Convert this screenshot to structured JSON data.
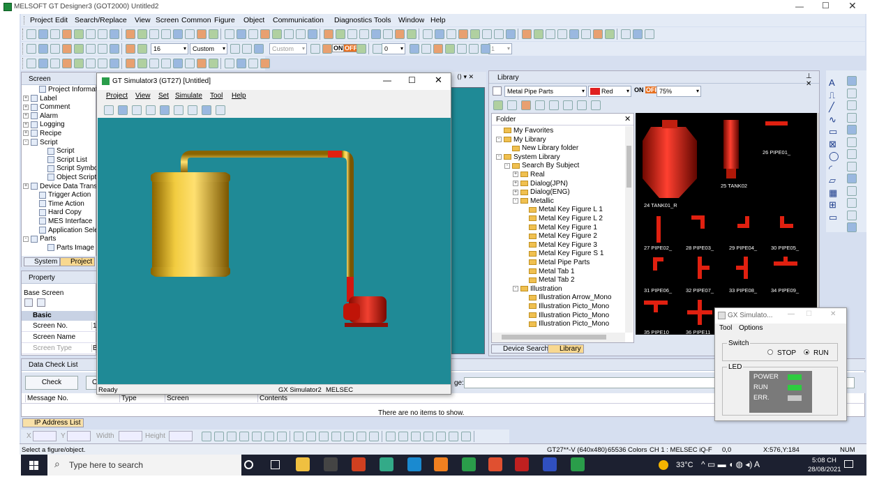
{
  "app": {
    "title": "MELSOFT GT Designer3 (GOT2000) Untitled2"
  },
  "menu": [
    "Project",
    "Edit",
    "Search/Replace",
    "View",
    "Screen",
    "Common",
    "Figure",
    "Object",
    "Communication",
    "Diagnostics",
    "Tools",
    "Window",
    "Help"
  ],
  "toolbar2": {
    "font_size": "16",
    "font_name": "Custom",
    "text_style": "Custom",
    "on_label": "ON",
    "off_label": "OFF",
    "value0": "0",
    "value1": "1"
  },
  "screen_pane": {
    "title": "Screen",
    "tabs": [
      "System",
      "Project"
    ],
    "tree": [
      {
        "label": "Project Information",
        "indent": 1,
        "exp": ""
      },
      {
        "label": "Label",
        "indent": 0,
        "exp": "+"
      },
      {
        "label": "Comment",
        "indent": 0,
        "exp": "+"
      },
      {
        "label": "Alarm",
        "indent": 0,
        "exp": "+"
      },
      {
        "label": "Logging",
        "indent": 0,
        "exp": "+"
      },
      {
        "label": "Recipe",
        "indent": 0,
        "exp": "+"
      },
      {
        "label": "Script",
        "indent": 0,
        "exp": "-"
      },
      {
        "label": "Script",
        "indent": 2,
        "exp": ""
      },
      {
        "label": "Script List",
        "indent": 2,
        "exp": ""
      },
      {
        "label": "Script Symbol",
        "indent": 2,
        "exp": ""
      },
      {
        "label": "Object Script",
        "indent": 2,
        "exp": ""
      },
      {
        "label": "Device Data Transfer",
        "indent": 0,
        "exp": "+"
      },
      {
        "label": "Trigger Action",
        "indent": 1,
        "exp": ""
      },
      {
        "label": "Time Action",
        "indent": 1,
        "exp": ""
      },
      {
        "label": "Hard Copy",
        "indent": 1,
        "exp": ""
      },
      {
        "label": "MES Interface",
        "indent": 1,
        "exp": ""
      },
      {
        "label": "Application Select",
        "indent": 1,
        "exp": ""
      },
      {
        "label": "Parts",
        "indent": 0,
        "exp": "-"
      },
      {
        "label": "Parts Image List",
        "indent": 2,
        "exp": ""
      }
    ]
  },
  "property_pane": {
    "title": "Property",
    "subtitle": "Base Screen",
    "section": "Basic",
    "rows": [
      {
        "name": "Screen No.",
        "value": "1"
      },
      {
        "name": "Screen Name",
        "value": ""
      },
      {
        "name": "Screen Type",
        "value": "B"
      }
    ]
  },
  "data_check": {
    "title": "Data Check List",
    "check_button": "Check",
    "other_button": "O",
    "page_label": "ge:",
    "columns": [
      "Message No.",
      "Type",
      "Screen",
      "Contents"
    ],
    "empty_text": "There are no items to show."
  },
  "ip_tab": "IP Address List",
  "toolbar_bottom": {
    "x_label": "X",
    "y_label": "Y",
    "width_label": "Width",
    "height_label": "Height"
  },
  "status_bar": {
    "left": "Select a figure/object.",
    "model": "GT27**-V (640x480)",
    "colors": "65536 Colors",
    "channel": "CH 1 : MELSEC iQ-F",
    "coord0": "0,0",
    "coords": "X:576,Y:184",
    "num": "NUM"
  },
  "simulator": {
    "title": "GT Simulator3 (GT27)  [Untitled]",
    "menu": [
      "Project",
      "View",
      "Set",
      "Simulate",
      "Tool",
      "Help"
    ],
    "status_left": "Ready",
    "status_mid": "GX Simulator2",
    "status_right": "MELSEC"
  },
  "library": {
    "title": "Library",
    "category": "Metal Pipe Parts",
    "color": "Red",
    "on": "ON",
    "off": "OFF",
    "zoom": "75%",
    "folder_title": "Folder",
    "tree": [
      {
        "label": "My Favorites",
        "indent": 1,
        "exp": ""
      },
      {
        "label": "My Library",
        "indent": 1,
        "exp": "-"
      },
      {
        "label": "New Library folder",
        "indent": 2,
        "exp": ""
      },
      {
        "label": "System Library",
        "indent": 1,
        "exp": "-"
      },
      {
        "label": "Search By Subject",
        "indent": 2,
        "exp": "-"
      },
      {
        "label": "Real",
        "indent": 3,
        "exp": "+"
      },
      {
        "label": "Dialog(JPN)",
        "indent": 3,
        "exp": "+"
      },
      {
        "label": "Dialog(ENG)",
        "indent": 3,
        "exp": "+"
      },
      {
        "label": "Metallic",
        "indent": 3,
        "exp": "-"
      },
      {
        "label": "Metal Key Figure L 1",
        "indent": 4,
        "exp": ""
      },
      {
        "label": "Metal Key Figure L 2",
        "indent": 4,
        "exp": ""
      },
      {
        "label": "Metal Key Figure 1",
        "indent": 4,
        "exp": ""
      },
      {
        "label": "Metal Key Figure 2",
        "indent": 4,
        "exp": ""
      },
      {
        "label": "Metal Key Figure 3",
        "indent": 4,
        "exp": ""
      },
      {
        "label": "Metal Key Figure S 1",
        "indent": 4,
        "exp": ""
      },
      {
        "label": "Metal Pipe Parts",
        "indent": 4,
        "exp": ""
      },
      {
        "label": "Metal Tab 1",
        "indent": 4,
        "exp": ""
      },
      {
        "label": "Metal Tab 2",
        "indent": 4,
        "exp": ""
      },
      {
        "label": "Illustration",
        "indent": 3,
        "exp": "-"
      },
      {
        "label": "Illustration Arrow_Mono",
        "indent": 4,
        "exp": ""
      },
      {
        "label": "Illustration Picto_Mono",
        "indent": 4,
        "exp": ""
      },
      {
        "label": "Illustration Picto_Mono",
        "indent": 4,
        "exp": ""
      },
      {
        "label": "Illustration Picto_Mono",
        "indent": 4,
        "exp": ""
      }
    ],
    "parts": [
      "26 PIPE01_",
      "25 TANK02",
      "24 TANK01_R",
      "27 PIPE02_",
      "28 PIPE03_",
      "29 PIPE04_",
      "30 PIPE05_",
      "31 PIPE06_",
      "32 PIPE07_",
      "33 PIPE08_",
      "34 PIPE09_",
      "35 PIPE10",
      "36 PIPE11"
    ],
    "tabs": [
      "Device Search",
      "Library"
    ]
  },
  "gx_sim": {
    "title": "GX Simulato...",
    "menu": [
      "Tool",
      "Options"
    ],
    "switch_label": "Switch",
    "stop": "STOP",
    "run": "RUN",
    "led_label": "LED",
    "leds": [
      {
        "name": "POWER",
        "color": "#2ecc40"
      },
      {
        "name": "RUN",
        "color": "#2ecc40"
      },
      {
        "name": "ERR.",
        "color": "#c8c8c8"
      }
    ]
  },
  "taskbar": {
    "search_placeholder": "Type here to search",
    "temp": "33°C",
    "time": "5:08 CH",
    "date": "28/08/2021"
  }
}
